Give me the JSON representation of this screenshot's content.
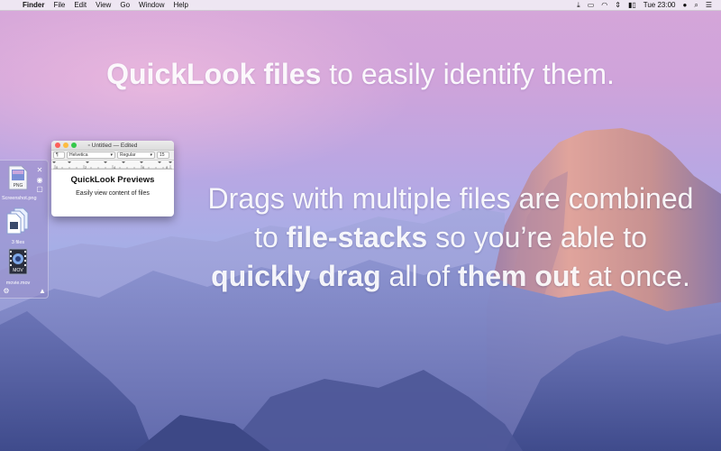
{
  "menubar": {
    "app_name": "Finder",
    "menus": [
      "File",
      "Edit",
      "View",
      "Go",
      "Window",
      "Help"
    ],
    "clock": "Tue 23:00"
  },
  "headline": {
    "bold": "QuickLook files",
    "rest": " to easily identify them."
  },
  "subtext": {
    "line1": "Drags with multiple files are combined",
    "line2_pre": "to ",
    "line2_bold": "file-stacks",
    "line2_post": " so you’re able to",
    "line3_bold1": "quickly drag",
    "line3_mid": " all of ",
    "line3_bold2": "them out",
    "line3_post": " at once."
  },
  "shelf": {
    "items": [
      {
        "label": "Screenshot.png",
        "badge": "PNG"
      },
      {
        "label": "3 files"
      },
      {
        "label": "movie.mov",
        "badge": "MOV"
      }
    ]
  },
  "window": {
    "title": "Untitled",
    "status": "— Edited",
    "paragraph_style": "¶",
    "font": "Helvetica",
    "weight": "Regular",
    "size": "15",
    "ruler_marks": [
      "0",
      "2",
      "4",
      "6",
      "8"
    ],
    "doc_title": "QuickLook Previews",
    "doc_body": "Easily view content of files"
  },
  "colors": {
    "traffic_red": "#fc605b",
    "traffic_yellow": "#fdbc40",
    "traffic_green": "#34c84a"
  }
}
